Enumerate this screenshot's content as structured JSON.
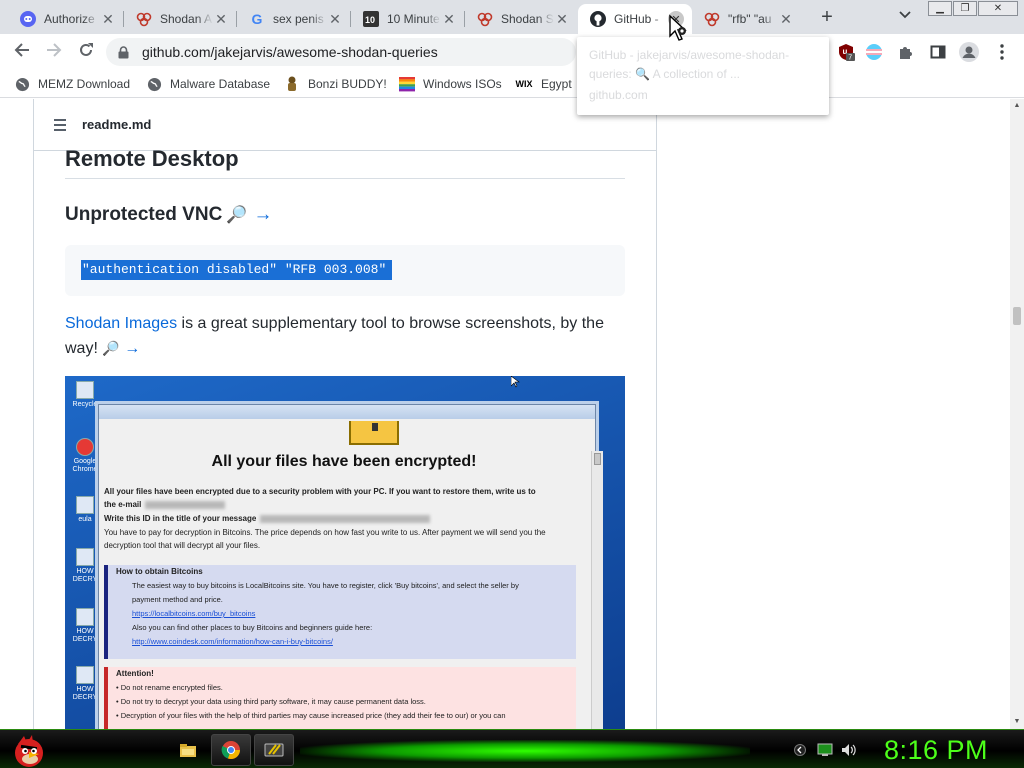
{
  "tabs": [
    {
      "title": "Authorize",
      "icon": "discord-icon"
    },
    {
      "title": "Shodan A",
      "icon": "shodan-icon"
    },
    {
      "title": "sex penis",
      "icon": "google-icon"
    },
    {
      "title": "10 Minute",
      "icon": "ten-minute-mail-icon"
    },
    {
      "title": "Shodan S",
      "icon": "shodan-icon"
    },
    {
      "title": "GitHub - ",
      "icon": "github-icon",
      "active": true
    },
    {
      "title": "\"rfb\" \"au",
      "icon": "shodan-icon"
    }
  ],
  "toolbar": {
    "url": "github.com/jakejarvis/awesome-shodan-queries"
  },
  "bookmarks": [
    {
      "label": "MEMZ Download",
      "icon": "globe-icon"
    },
    {
      "label": "Malware Database",
      "icon": "globe-icon"
    },
    {
      "label": "Bonzi BUDDY!",
      "icon": "bonzi-icon"
    },
    {
      "label": "Windows ISOs",
      "icon": "windows-flag-icon"
    },
    {
      "label": "Egypt",
      "icon": "wix-icon"
    }
  ],
  "wix_label": "WIX",
  "tooltip": {
    "title": "GitHub - jakejarvis/awesome-shodan-queries: 🔍 A collection of ...",
    "host": "github.com"
  },
  "extension_badge": "7",
  "readme": {
    "filename": "readme.md",
    "section_heading": "Remote Desktop",
    "sub_heading": "Unprotected VNC",
    "arrow": "→",
    "search_glyph": "🔎",
    "query": "\"authentication disabled\" \"RFB 003.008\"",
    "para_link": "Shodan Images",
    "para_text": " is a great supplementary tool to browse screenshots, by the way! "
  },
  "screenshot": {
    "desk_icons": [
      "Recycle",
      "Google Chrome",
      "eula",
      "HOW DECRY",
      "HOW DECRY",
      "HOW DECRY"
    ],
    "heading": "All your files have been encrypted!",
    "p1a": "All your files have been encrypted due to a security problem with your PC. If you want to restore them, write us to",
    "p1b": "the e-mail",
    "p2": "Write this ID in the title of your message",
    "p3": "You have to pay for decryption in Bitcoins. The price depends on how fast you write to us. After payment we will send you the",
    "p4": "decryption tool that will decrypt all your files.",
    "b_head": "How to obtain Bitcoins",
    "b1": "The easiest way to buy bitcoins is LocalBitcoins site. You have to register, click 'Buy bitcoins', and select the seller by",
    "b2": "payment method and price.",
    "b3": "https://localbitcoins.com/buy_bitcoins",
    "b4": "Also you can find other places to buy Bitcoins and beginners guide here:",
    "b5": "http://www.coindesk.com/information/how-can-i-buy-bitcoins/",
    "a_head": "Attention!",
    "a1": "Do not rename encrypted files.",
    "a2": "Do not try to decrypt your data using third party software, it may cause permanent data loss.",
    "a3": "Decryption of your files with the help of third parties may cause increased price (they add their fee to our) or you can"
  },
  "taskbar": {
    "clock": "8:16 PM",
    "pinned": [
      "folder-icon",
      "chrome-icon",
      "app-icon"
    ]
  },
  "colors": {
    "accent_link": "#0969da",
    "selection": "#1a6fd6",
    "clock_green": "#4dff1a"
  }
}
